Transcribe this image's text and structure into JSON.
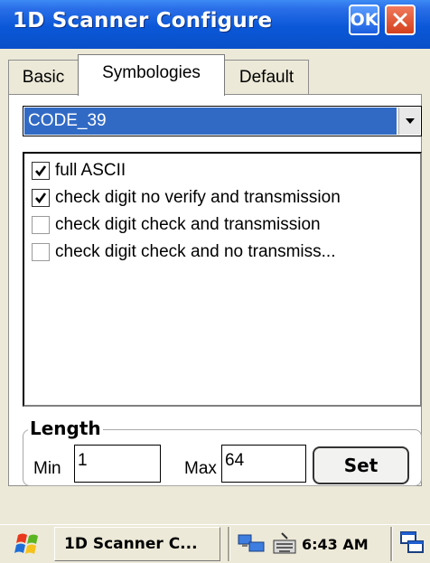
{
  "window": {
    "title": "1D Scanner Configure",
    "ok_label": "OK",
    "close_icon": "close-icon"
  },
  "tabs": [
    {
      "label": "Basic",
      "active": false
    },
    {
      "label": "Symbologies",
      "active": true
    },
    {
      "label": "Default",
      "active": false
    }
  ],
  "symbology_select": {
    "value": "CODE_39"
  },
  "options": [
    {
      "label": "full ASCII",
      "checked": true
    },
    {
      "label": "check digit no verify and transmission",
      "checked": true
    },
    {
      "label": "check digit check and transmission",
      "checked": false
    },
    {
      "label": "check digit check and no transmiss...",
      "checked": false
    }
  ],
  "length": {
    "title": "Length",
    "min_label": "Min",
    "min_value": "1",
    "max_label": "Max",
    "max_value": "64",
    "set_label": "Set"
  },
  "taskbar": {
    "start_icon": "windows-flag-icon",
    "task_label": "1D Scanner C...",
    "clock": "6:43 AM",
    "tray_icons": [
      "network-icon",
      "keyboard-icon",
      "desktop-icon"
    ]
  },
  "colors": {
    "titlebar": "#0a58d8",
    "selection": "#316ac5",
    "face": "#ece9d8"
  }
}
